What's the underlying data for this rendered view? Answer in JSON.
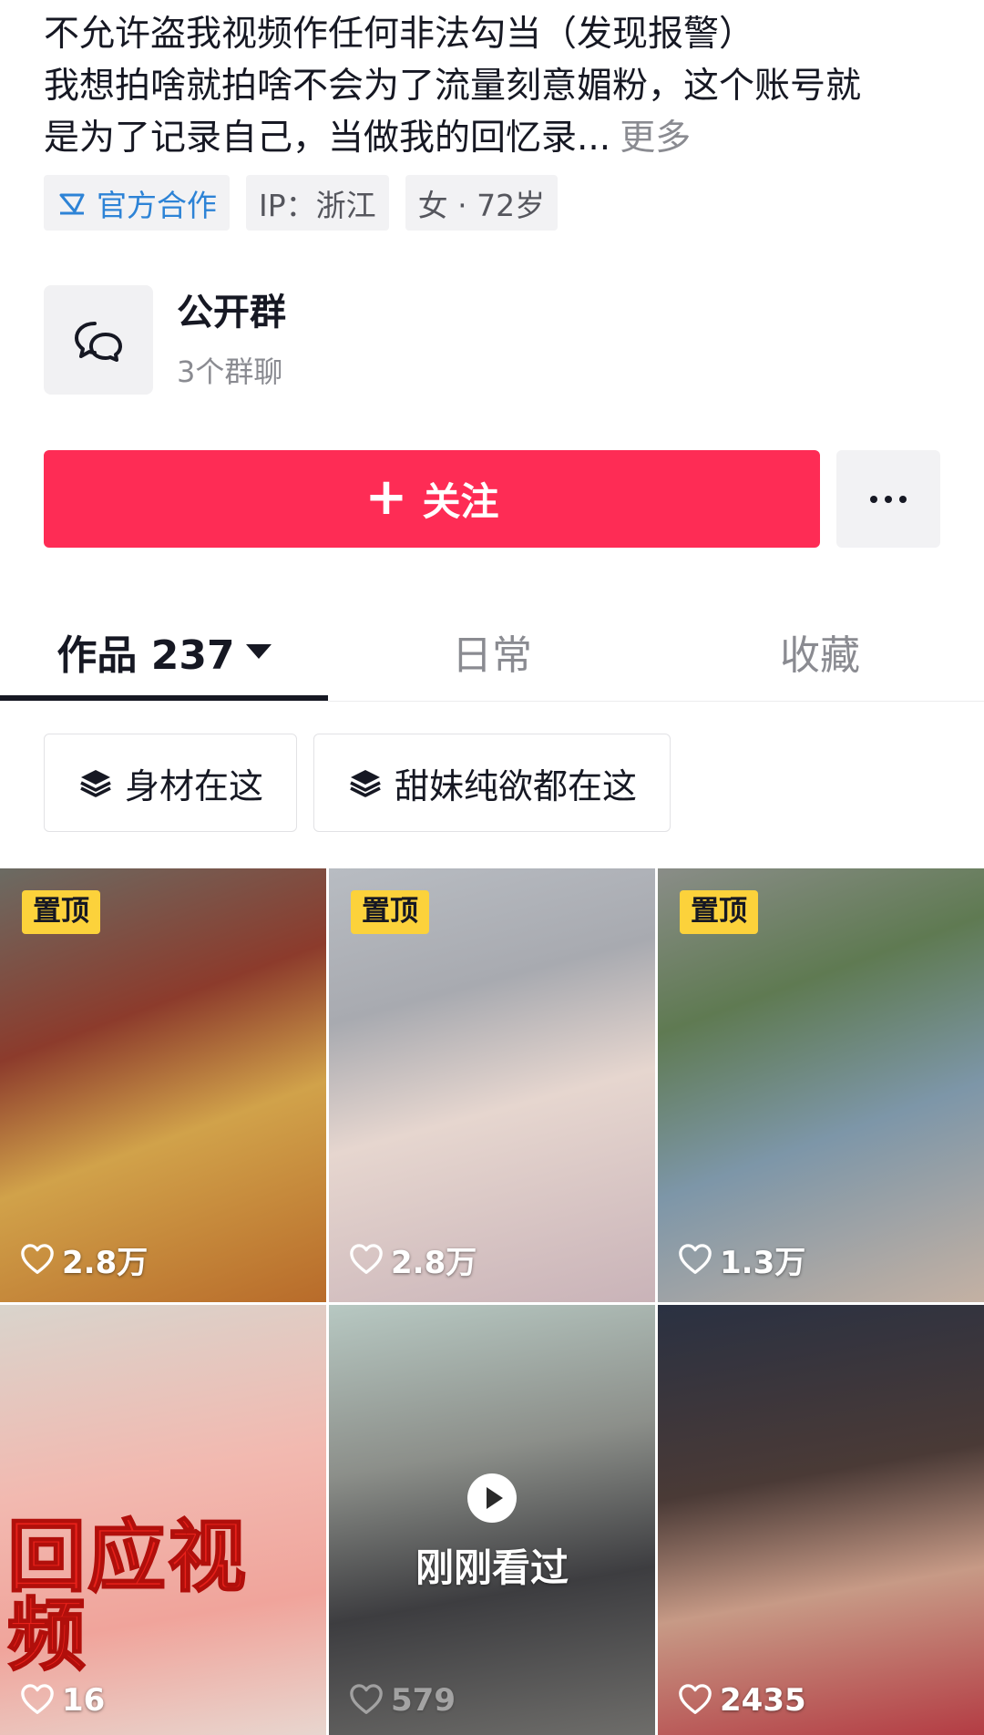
{
  "bio": {
    "line0_visible": "",
    "line1": "不允许盗我视频作任何非法勾当（发现报警）",
    "line2": "我想拍啥就拍啥不会为了流量刻意媚粉，这个账号就",
    "line3": "是为了记录自己，当做我的回忆录...",
    "more": "更多"
  },
  "tags": {
    "official": "官方合作",
    "ip": "IP：浙江",
    "gender_age": "女 · 72岁"
  },
  "group": {
    "title": "公开群",
    "subtitle": "3个群聊"
  },
  "follow_button": {
    "label": "关注",
    "plus": "+"
  },
  "tabs": [
    {
      "label": "作品 237"
    },
    {
      "label": "日常"
    },
    {
      "label": "收藏"
    }
  ],
  "collections": [
    {
      "label": "身材在这"
    },
    {
      "label": "甜妹纯欲都在这"
    }
  ],
  "videos": [
    {
      "pinned": "置顶",
      "likes": "2.8万"
    },
    {
      "pinned": "置顶",
      "likes": "2.8万"
    },
    {
      "pinned": "置顶",
      "likes": "1.3万"
    },
    {
      "overlay_text": "回应视频",
      "likes": "16"
    },
    {
      "seen_label": "刚刚看过",
      "likes": "579"
    },
    {
      "likes": "2435"
    }
  ],
  "colors": {
    "accent": "#fe2c55",
    "pin_badge": "#fcd23b",
    "official_blue": "#2d83d6"
  }
}
